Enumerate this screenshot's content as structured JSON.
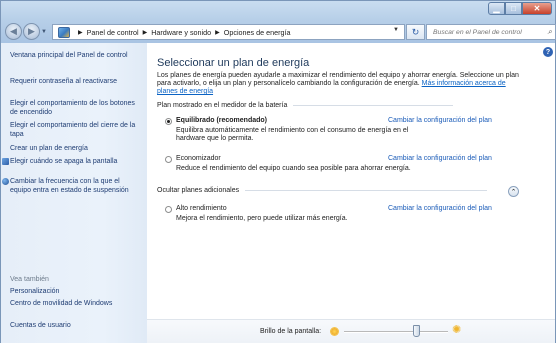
{
  "window": {
    "caption": {
      "minimize": "▁",
      "maximize": "□",
      "close": "✕"
    }
  },
  "address_bar": {
    "crumbs": [
      "Panel de control",
      "Hardware y sonido",
      "Opciones de energía"
    ],
    "search_placeholder": "Buscar en el Panel de control"
  },
  "sidebar": {
    "links": [
      "Ventana principal del Panel de control",
      "Requerir contraseña al reactivarse",
      "Elegir el comportamiento de los botones de encendido",
      "Elegir el comportamiento del cierre de la tapa",
      "Crear un plan de energía",
      "Elegir cuándo se apaga la pantalla",
      "Cambiar la frecuencia con la que el equipo entra en estado de suspensión"
    ],
    "see_also_title": "Vea también",
    "see_also": [
      "Personalización",
      "Centro de movilidad de Windows",
      "Cuentas de usuario"
    ]
  },
  "main": {
    "title": "Seleccionar un plan de energía",
    "intro": "Los planes de energía pueden ayudarle a maximizar el rendimiento del equipo y ahorrar energía. Seleccione un plan para activarlo, o elija un plan y personalícelo cambiando la configuración de energía.",
    "intro_link": "Más información acerca de planes de energía",
    "section_battery": "Plan mostrado en el medidor de la batería",
    "section_hidden": "Ocultar planes adicionales",
    "change_link": "Cambiar la configuración del plan",
    "plans": [
      {
        "name": "Equilibrado (recomendado)",
        "desc": "Equilibra automáticamente el rendimiento con el consumo de energía en el hardware que lo permita.",
        "selected": true
      },
      {
        "name": "Economizador",
        "desc": "Reduce el rendimiento del equipo cuando sea posible para ahorrar energía.",
        "selected": false
      },
      {
        "name": "Alto rendimiento",
        "desc": "Mejora el rendimiento, pero puede utilizar más energía.",
        "selected": false
      }
    ]
  },
  "brightness": {
    "label": "Brillo de la pantalla:",
    "level": 0.7
  },
  "colors": {
    "link": "#1a5bb8",
    "sidebar_link": "#1f3d73",
    "title": "#1e395b"
  }
}
